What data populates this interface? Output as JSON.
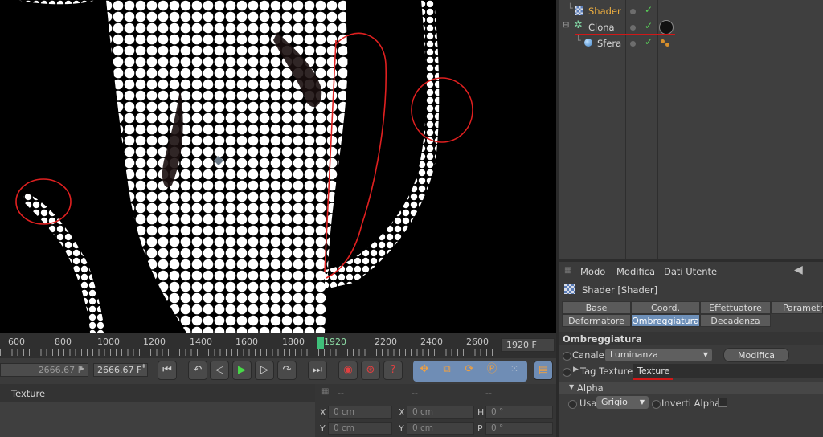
{
  "object_manager": {
    "objects": [
      {
        "name": "Shader",
        "icon": "checker-shader-icon",
        "color": "#f0b040"
      },
      {
        "name": "Clona",
        "icon": "cloner-icon",
        "color": "#d6d6d6"
      },
      {
        "name": "Sfera",
        "icon": "sphere-icon",
        "color": "#d6d6d6"
      }
    ]
  },
  "attribute_manager": {
    "menu": [
      "Modo",
      "Modifica",
      "Dati Utente"
    ],
    "title": "Shader [Shader]",
    "tabs_row1": [
      "Base",
      "Coord.",
      "Effettuatore",
      "Parametro"
    ],
    "tabs_row2": [
      "Deformatore",
      "Ombreggiatura",
      "Decadenza"
    ],
    "active_tab": "Ombreggiatura",
    "section_title": "Ombreggiatura",
    "canale_label": "Canale",
    "canale_value": "Luminanza",
    "modifica_button": "Modifica",
    "tag_texture_label": "Tag Texture",
    "tag_texture_value": "Texture",
    "alpha_section": "Alpha",
    "usa_label": "Usa",
    "usa_value": "Grigio",
    "invert_alpha_label": "Inverti Alpha"
  },
  "timeline": {
    "ticks": [
      "600",
      "800",
      "1000",
      "1200",
      "1400",
      "1600",
      "1800",
      "2200",
      "2400",
      "2600"
    ],
    "current_frame": "1920",
    "frame_field": "1920 F"
  },
  "transport": {
    "start_field": "2666.67 F",
    "end_field": "2666.67 F"
  },
  "material_panel": {
    "label": "Texture"
  },
  "coord_panel": {
    "header": [
      "--",
      "--",
      "--"
    ],
    "rows": [
      {
        "a_label": "X",
        "a_value": "0 cm",
        "b_label": "X",
        "b_value": "0 cm",
        "c_label": "H",
        "c_value": "0 °"
      },
      {
        "a_label": "Y",
        "a_value": "0 cm",
        "b_label": "Y",
        "b_value": "0 cm",
        "c_label": "P",
        "c_value": "0 °"
      }
    ]
  },
  "colors": {
    "accent_active_tab": "#6d8fb8",
    "annotation_red": "#e02020",
    "shader_label": "#f0b040"
  }
}
